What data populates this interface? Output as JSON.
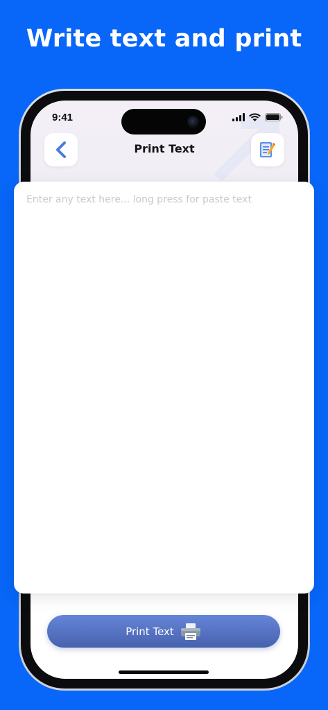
{
  "promo": {
    "headline": "Write text and print"
  },
  "status_bar": {
    "time": "9:41"
  },
  "header": {
    "title": "Print Text"
  },
  "editor": {
    "placeholder": "Enter any text here... long press for paste text",
    "value": ""
  },
  "print_button": {
    "label": "Print Text"
  },
  "colors": {
    "background": "#0866f8",
    "button": "#5572c4",
    "accent": "#4b7be0"
  },
  "icons": {
    "back": "chevron-left-icon",
    "notes": "notepad-pencil-icon",
    "print": "printer-icon",
    "signal": "cellular-signal-icon",
    "wifi": "wifi-icon",
    "battery": "battery-icon"
  }
}
